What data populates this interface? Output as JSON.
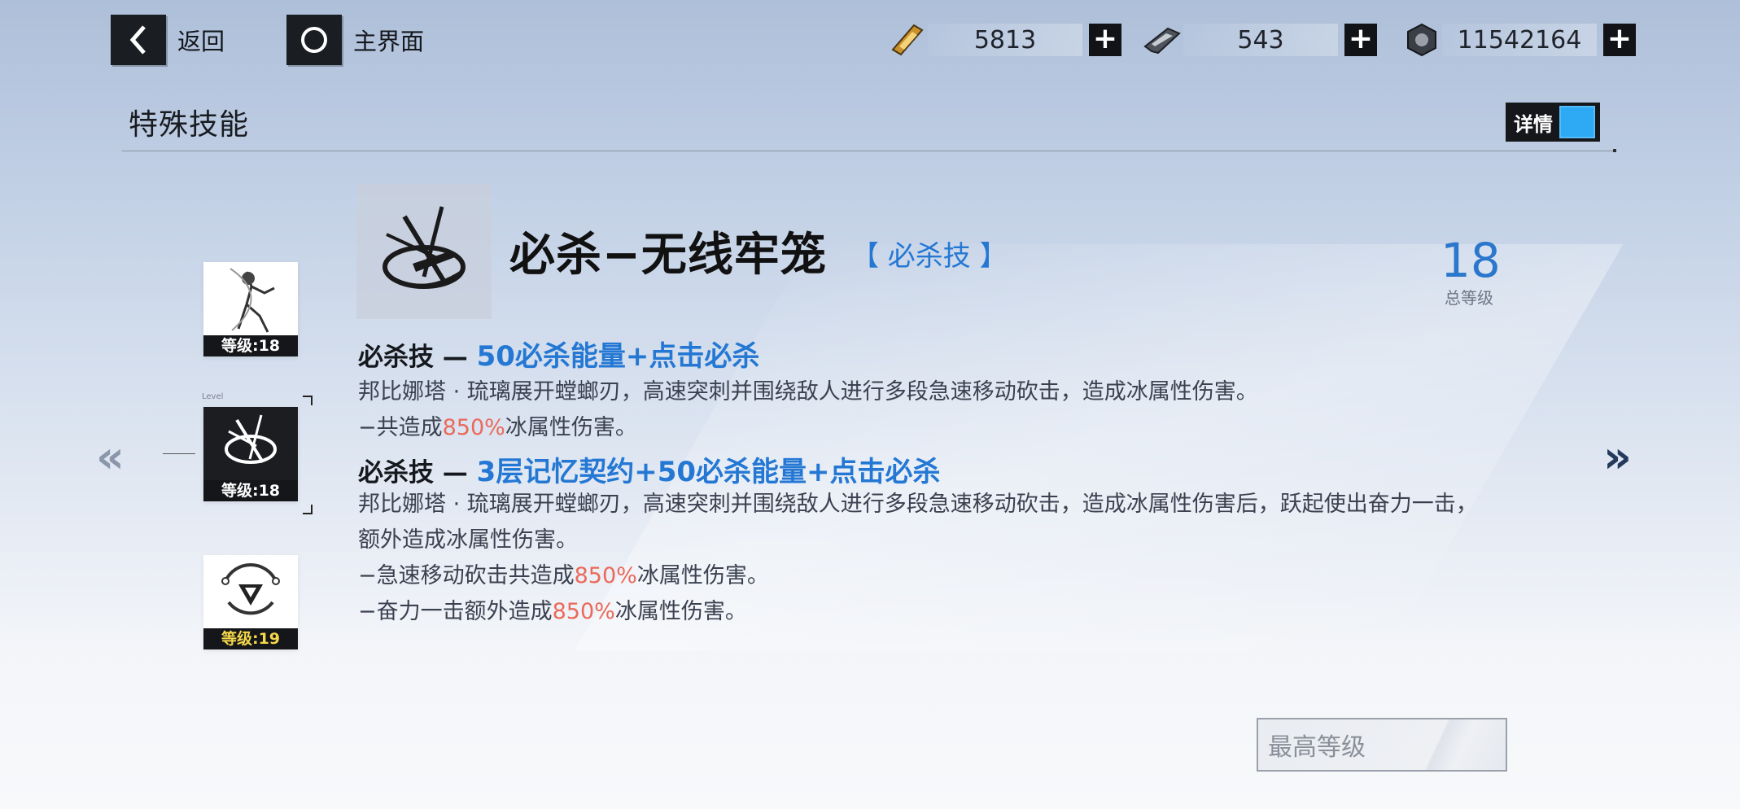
{
  "topbar": {
    "back_label": "返回",
    "home_label": "主界面",
    "currencies": [
      {
        "icon": "gold-card-icon",
        "value": "5813"
      },
      {
        "icon": "chip-card-icon",
        "value": "543"
      },
      {
        "icon": "hex-nut-icon",
        "value": "11542164"
      }
    ],
    "plus_symbol": "+"
  },
  "section": {
    "title": "特殊技能",
    "details_toggle_label": "详情",
    "details_toggle_on": true
  },
  "skill_list": [
    {
      "level_text": "等级:18",
      "icon": "character-portrait-icon"
    },
    {
      "level_text": "等级:18",
      "icon": "slash-skill-icon",
      "selected": true,
      "tiny_label": "Level"
    },
    {
      "level_text": "等级:19",
      "icon": "triangle-emblem-icon",
      "level_color": "#f5d84a"
    }
  ],
  "nav_arrows": {
    "prev": "«",
    "next": "»"
  },
  "skill": {
    "name": "必杀−无线牢笼",
    "tag": "【 必杀技 】",
    "total_level": "18",
    "total_level_label": "总等级",
    "entries": [
      {
        "head_prefix": "必杀技 — ",
        "head_highlight": "50必杀能量+点击必杀",
        "lines": [
          {
            "text": "邦比娜塔 · 琉璃展开螳螂刃，高速突刺并围绕敌人进行多段急速移动砍击，造成冰属性伤害。"
          },
          {
            "pre": "−共造成",
            "red": "850%",
            "post": "冰属性伤害。"
          }
        ]
      },
      {
        "head_prefix": "必杀技 — ",
        "head_highlight": "3层记忆契约+50必杀能量+点击必杀",
        "lines": [
          {
            "text": "邦比娜塔 · 琉璃展开螳螂刃，高速突刺并围绕敌人进行多段急速移动砍击，造成冰属性伤害后，跃起使出奋力一击，额外造成冰属性伤害。"
          },
          {
            "pre": "−急速移动砍击共造成",
            "red": "850%",
            "post": "冰属性伤害。"
          },
          {
            "pre": "−奋力一击额外造成",
            "red": "850%",
            "post": "冰属性伤害。"
          }
        ]
      }
    ]
  },
  "max_level_button": "最高等级",
  "colors": {
    "accent_blue": "#2478d4",
    "damage_red": "#ea6a5a",
    "toggle_blue": "#2eaaf5"
  }
}
